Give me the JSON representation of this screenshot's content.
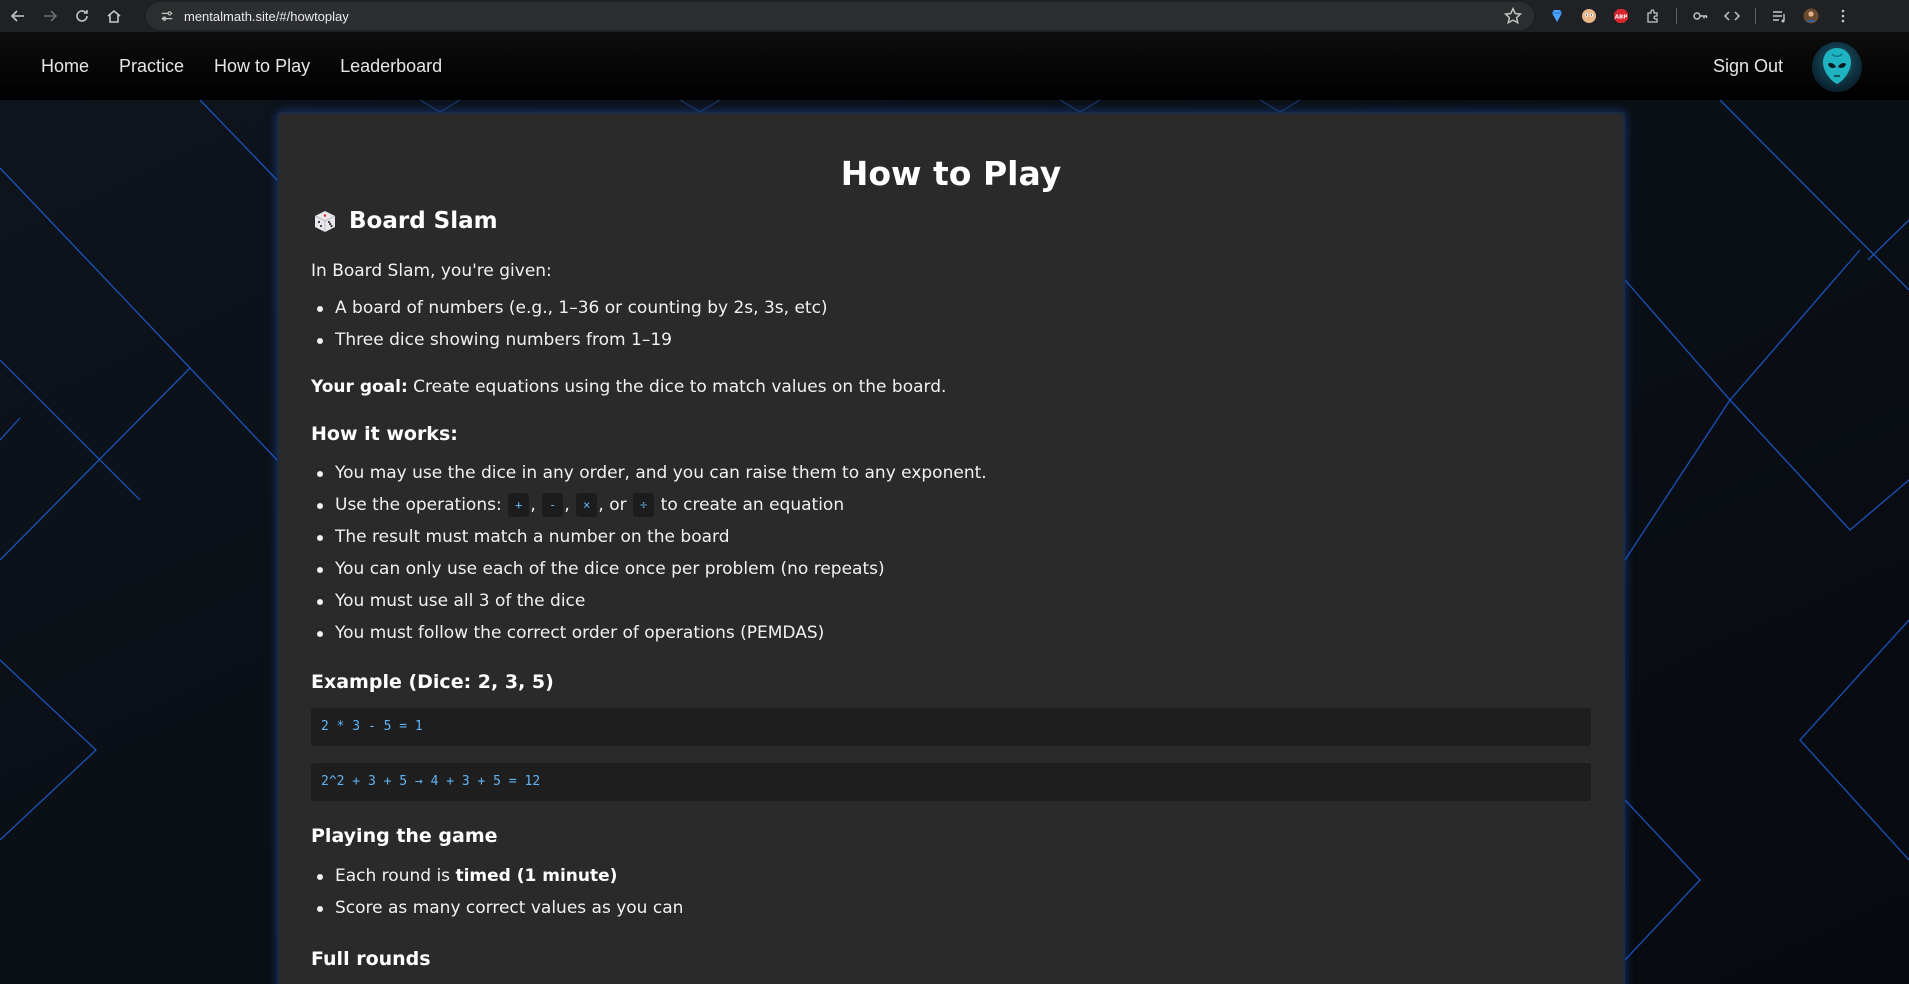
{
  "browser": {
    "url": "mentalmath.site/#/howtoplay"
  },
  "nav": {
    "links": [
      "Home",
      "Practice",
      "How to Play",
      "Leaderboard"
    ],
    "sign_out": "Sign Out"
  },
  "page": {
    "title": "How to Play",
    "section_title": "Board Slam",
    "intro": "In Board Slam, you're given:",
    "given": [
      "A board of numbers (e.g., 1–36 or counting by 2s, 3s, etc)",
      "Three dice showing numbers from 1–19"
    ],
    "goal_label": "Your goal:",
    "goal_text": " Create equations using the dice to match values on the board.",
    "how_heading": "How it works:",
    "rules": {
      "r1": "You may use the dice in any order, and you can raise them to any exponent.",
      "r2_prefix": "Use the operations: ",
      "ops": [
        "+",
        "-",
        "×",
        "÷"
      ],
      "r2_sep1": ",",
      "r2_sep2": ",",
      "r2_sep3": ", or",
      "r2_suffix": " to create an equation",
      "r3": "The result must match a number on the board",
      "r4": "You can only use each of the dice once per problem (no repeats)",
      "r5": "You must use all 3 of the dice",
      "r6": "You must follow the correct order of operations (PEMDAS)"
    },
    "example_heading": "Example (Dice: 2, 3, 5)",
    "examples": [
      "2 * 3 - 5 = 1",
      "2^2 + 3 + 5 → 4 + 3 + 5 = 12"
    ],
    "playing_heading": "Playing the game",
    "playing": {
      "p1_prefix": "Each round is ",
      "p1_bold": "timed (1 minute)",
      "p2": "Score as many correct values as you can"
    },
    "full_rounds_heading": "Full rounds"
  },
  "colors": {
    "card_bg": "#2a2a2a",
    "code_text": "#5fb4f5",
    "page_bg": "#0b0f16"
  }
}
